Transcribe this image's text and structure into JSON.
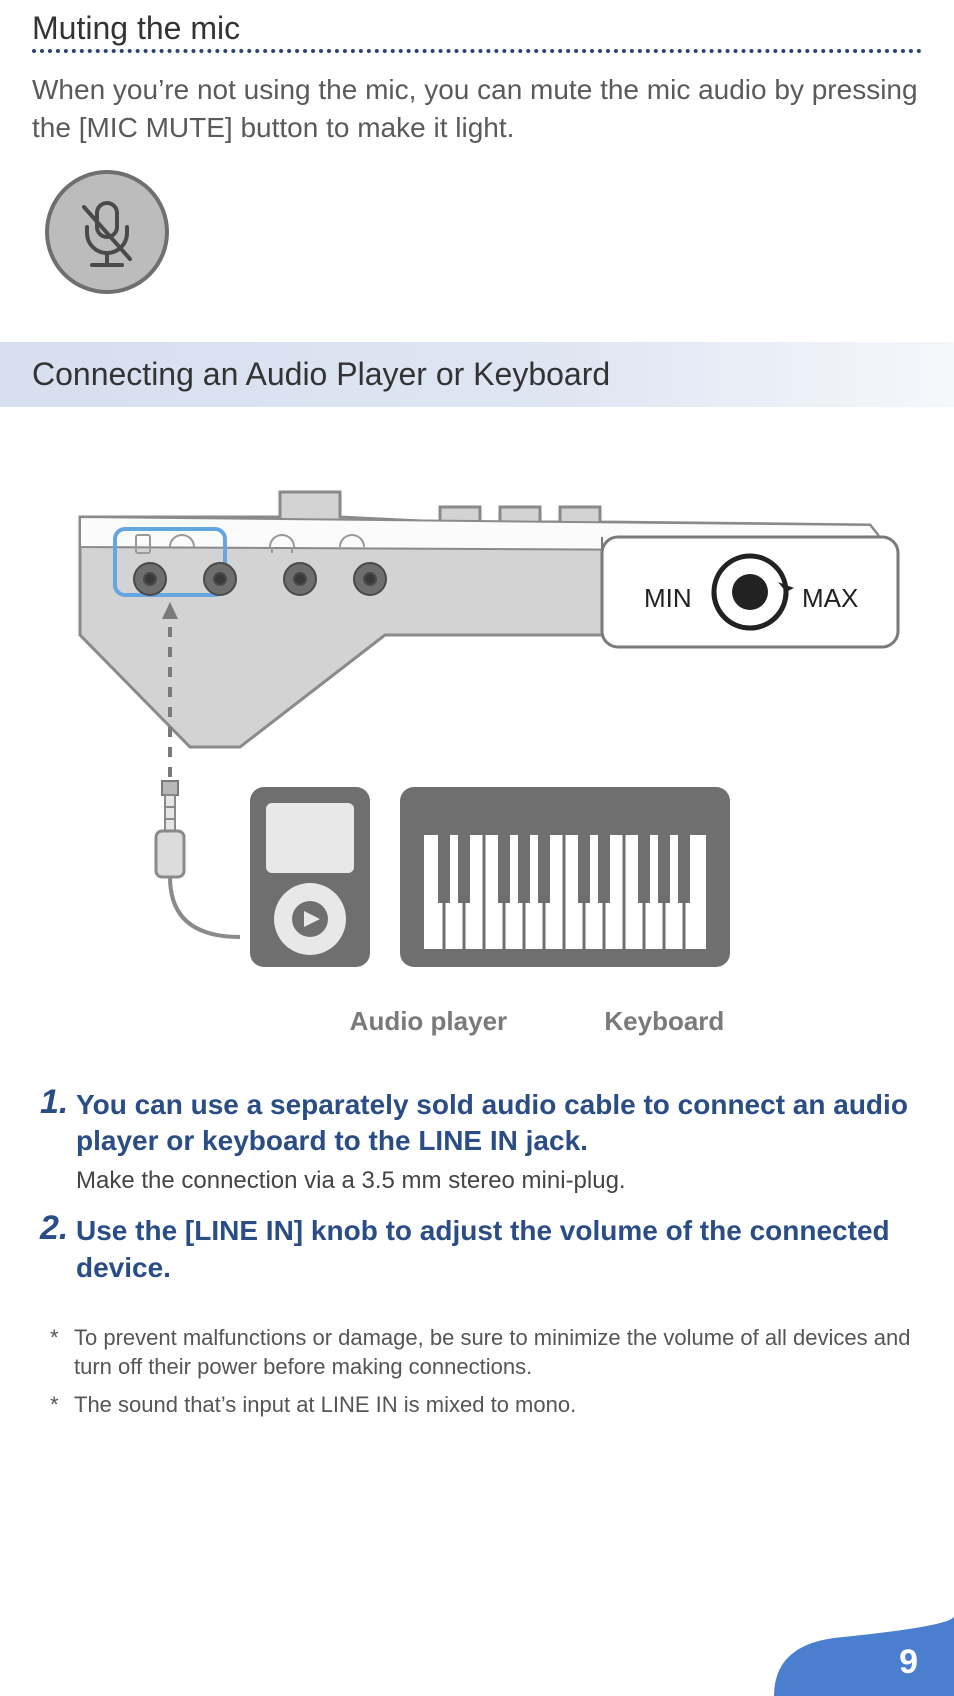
{
  "muting": {
    "heading": "Muting the mic",
    "body": "When you’re not using the mic, you can mute the mic audio by pressing the [MIC MUTE] button to make it light."
  },
  "connecting": {
    "heading": "Connecting an Audio Player or Keyboard",
    "knob_min": "MIN",
    "knob_max": "MAX",
    "label_audio": "Audio player",
    "label_keyboard": "Keyboard"
  },
  "steps": [
    {
      "num": "1.",
      "title": "You can use a separately sold audio cable to connect an audio player or keyboard to the LINE IN jack.",
      "sub": "Make the connection via a 3.5 mm stereo mini-plug."
    },
    {
      "num": "2.",
      "title": "Use the [LINE IN] knob to adjust the volume of the connected device.",
      "sub": ""
    }
  ],
  "notes": [
    "To prevent malfunctions or damage, be sure to minimize the volume of all devices and turn off their power before making connections.",
    "The sound that’s input at LINE IN is mixed to mono."
  ],
  "page_number": "9"
}
